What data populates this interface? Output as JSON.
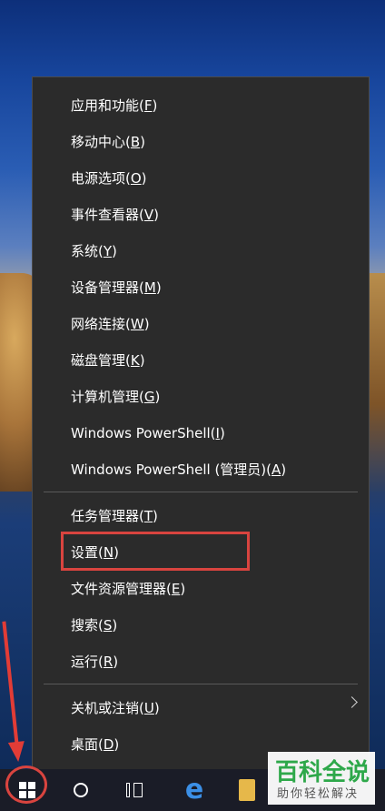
{
  "menu": {
    "items": [
      {
        "label": "应用和功能(",
        "acc": "F",
        "end": ")"
      },
      {
        "label": "移动中心(",
        "acc": "B",
        "end": ")"
      },
      {
        "label": "电源选项(",
        "acc": "O",
        "end": ")"
      },
      {
        "label": "事件查看器(",
        "acc": "V",
        "end": ")"
      },
      {
        "label": "系统(",
        "acc": "Y",
        "end": ")"
      },
      {
        "label": "设备管理器(",
        "acc": "M",
        "end": ")"
      },
      {
        "label": "网络连接(",
        "acc": "W",
        "end": ")"
      },
      {
        "label": "磁盘管理(",
        "acc": "K",
        "end": ")"
      },
      {
        "label": "计算机管理(",
        "acc": "G",
        "end": ")"
      },
      {
        "label": "Windows PowerShell(",
        "acc": "I",
        "end": ")"
      },
      {
        "label": "Windows PowerShell (管理员)(",
        "acc": "A",
        "end": ")"
      },
      {
        "label": "任务管理器(",
        "acc": "T",
        "end": ")"
      },
      {
        "label": "设置(",
        "acc": "N",
        "end": ")"
      },
      {
        "label": "文件资源管理器(",
        "acc": "E",
        "end": ")"
      },
      {
        "label": "搜索(",
        "acc": "S",
        "end": ")"
      },
      {
        "label": "运行(",
        "acc": "R",
        "end": ")"
      },
      {
        "label": "关机或注销(",
        "acc": "U",
        "end": ")"
      },
      {
        "label": "桌面(",
        "acc": "D",
        "end": ")"
      }
    ]
  },
  "taskbar": {
    "icons": [
      "windows-start-icon",
      "cortana-search-icon",
      "task-view-icon",
      "edge-browser-icon",
      "file-explorer-icon"
    ],
    "edge_glyph": "e"
  },
  "watermark": {
    "title": "百科全说",
    "subtitle": "助你轻松解决"
  },
  "colors": {
    "menu_bg": "#2b2b2b",
    "highlight": "#d9443f",
    "taskbar_bg": "#1a1c27",
    "watermark_green": "#2ea84a"
  }
}
